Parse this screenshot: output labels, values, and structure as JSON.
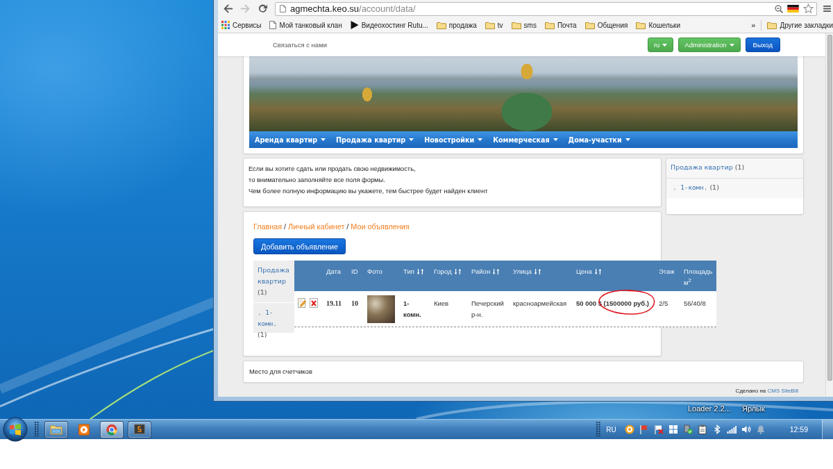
{
  "desktop": {
    "icon_labels": [
      {
        "text": "Loader 2.2..."
      },
      {
        "text": "Ярлык"
      }
    ]
  },
  "browser": {
    "address": {
      "host": "agmechta.keo.su",
      "path": "/account/data/"
    },
    "forward_disabled": true,
    "bookmarks": [
      {
        "kind": "apps",
        "label": "Сервисы"
      },
      {
        "kind": "page",
        "label": "Мой танковый клан"
      },
      {
        "kind": "video",
        "label": "Видеохостинг Rutu..."
      },
      {
        "kind": "folder",
        "label": "продажа"
      },
      {
        "kind": "folder",
        "label": "tv"
      },
      {
        "kind": "folder",
        "label": "sms"
      },
      {
        "kind": "folder",
        "label": "Почта"
      },
      {
        "kind": "folder",
        "label": "Общения"
      },
      {
        "kind": "folder",
        "label": "Кошельки"
      }
    ],
    "more": "»",
    "other_bookmarks": "Другие закладки"
  },
  "page": {
    "topbar": {
      "contact": "Связаться с нами",
      "buttons": [
        {
          "label": "ru",
          "kind": "success",
          "dropdown": true
        },
        {
          "label": "Administration",
          "kind": "success",
          "dropdown": true
        },
        {
          "label": "Выход",
          "kind": "primary",
          "dropdown": false
        }
      ]
    },
    "menu": [
      "Аренда квартир",
      "Продажа квартир",
      "Новостройки",
      "Коммерческая",
      "Дома-участки"
    ],
    "notice": [
      "Если вы хотите сдать или продать свою недвижимость,",
      "то внимательно заполняйте все поля формы.",
      "Чем более полную информацию вы укажете, тем быстрее будет найден клиент"
    ],
    "sidebar": {
      "title": "Продажа квартир",
      "count": "(1)",
      "items": [
        {
          "label": ". 1-комн.",
          "count": "(1)"
        }
      ]
    },
    "breadcrumb": [
      {
        "kind": "link",
        "text": "Главная"
      },
      {
        "kind": "separator",
        "text": "/"
      },
      {
        "kind": "link",
        "text": "Личный кабинет"
      },
      {
        "kind": "separator",
        "text": "/"
      },
      {
        "kind": "link",
        "text": "Мои объявления"
      }
    ],
    "add_button": "Добавить объявление",
    "filter": {
      "title": "Продажа квартир",
      "count": "(1)",
      "items": [
        {
          "label": ". 1-комн.",
          "count": "(1)"
        }
      ]
    },
    "table": {
      "columns": [
        {
          "label": "Дата",
          "sortable": false
        },
        {
          "label": "ID",
          "sortable": false
        },
        {
          "label": "Фото",
          "sortable": false
        },
        {
          "label": "Тип",
          "sortable": true
        },
        {
          "label": "Город",
          "sortable": true
        },
        {
          "label": "Район",
          "sortable": true
        },
        {
          "label": "Улица",
          "sortable": true
        },
        {
          "label": "Цена",
          "sortable": true
        },
        {
          "label": "Этаж",
          "sortable": false
        },
        {
          "label": "Площадь м$^{2}$",
          "sortable": false
        }
      ],
      "rows": [
        {
          "cells": [
            {
              "kind": "serif",
              "text": "19.11"
            },
            {
              "kind": "serif",
              "text": "10"
            },
            {
              "kind": "photo"
            },
            {
              "kind": "bold",
              "text": "1-комн."
            },
            {
              "kind": "plain",
              "text": "Киев"
            },
            {
              "kind": "plain",
              "text": "Печерский р-н."
            },
            {
              "kind": "plain",
              "text": "красноармейская"
            },
            {
              "kind": "bold",
              "text": "50 000 $ (1500000 руб.)",
              "circled": true
            },
            {
              "kind": "plain",
              "text": "2/5"
            },
            {
              "kind": "plain",
              "text": "56/40/8"
            }
          ]
        }
      ]
    },
    "counters": "Место для счетчиков",
    "credit": {
      "text": "Сделано на",
      "link": "CMS SiteBill"
    }
  },
  "taskbar": {
    "apps": [
      {
        "kind": "folder",
        "running": true,
        "selected": false
      },
      {
        "kind": "player",
        "running": false,
        "selected": false
      },
      {
        "kind": "browser",
        "running": true,
        "selected": true
      },
      {
        "kind": "console",
        "running": true,
        "selected": false
      }
    ],
    "language": "RU",
    "clock": "12:59"
  }
}
